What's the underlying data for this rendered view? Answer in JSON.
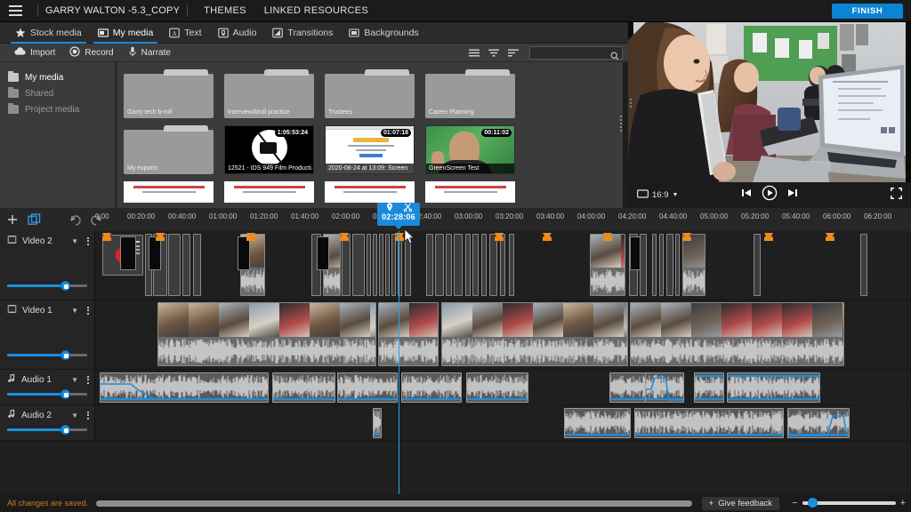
{
  "app": {
    "title": "GARRY WALTON -5.3_COPY",
    "nav": [
      "THEMES",
      "LINKED RESOURCES"
    ],
    "finish_label": "FINISH",
    "menu_icon": "hamburger-icon"
  },
  "media_tabs": [
    {
      "label": "Stock media",
      "icon": "star-icon",
      "active": false
    },
    {
      "label": "My media",
      "icon": "media-library-icon",
      "active": true
    },
    {
      "label": "Text",
      "icon": "text-icon",
      "active": false
    },
    {
      "label": "Audio",
      "icon": "audio-note-icon",
      "active": false
    },
    {
      "label": "Transitions",
      "icon": "transitions-icon",
      "active": false
    },
    {
      "label": "Backgrounds",
      "icon": "backgrounds-icon",
      "active": false
    }
  ],
  "action_bar": {
    "actions": [
      {
        "label": "Import",
        "icon": "cloud-upload-icon"
      },
      {
        "label": "Record",
        "icon": "record-circle-icon"
      },
      {
        "label": "Narrate",
        "icon": "microphone-icon"
      }
    ],
    "tools": [
      "list-view-icon",
      "filter-icon",
      "sort-icon"
    ],
    "search_placeholder": "",
    "search_value": "",
    "search_icon": "search-icon"
  },
  "left_nav": [
    {
      "label": "My media",
      "selected": true
    },
    {
      "label": "Shared",
      "selected": false
    },
    {
      "label": "Project media",
      "selected": false
    }
  ],
  "media_items": [
    {
      "type": "folder",
      "name": "Garry tech b-roll"
    },
    {
      "type": "folder",
      "name": "Interview/broll practice"
    },
    {
      "type": "folder",
      "name": "Trustees"
    },
    {
      "type": "folder",
      "name": "Career Planning"
    },
    {
      "type": "folder",
      "name": "My exports"
    },
    {
      "type": "video",
      "name": "12521 - IDS 949 Film Producti...",
      "duration": "1:05:53:24",
      "thumb": "no-video-icon"
    },
    {
      "type": "video",
      "name": "2020-08-24 at 13:09: Screen",
      "duration": "01:07:18",
      "thumb": "screen-recording"
    },
    {
      "type": "video",
      "name": "GreenScreen Test",
      "duration": "00:11:02",
      "thumb": "green-screen"
    },
    {
      "type": "document",
      "name": ""
    },
    {
      "type": "document",
      "name": ""
    },
    {
      "type": "document",
      "name": ""
    },
    {
      "type": "document",
      "name": ""
    }
  ],
  "preview": {
    "aspect_ratio": "16:9",
    "aspect_icon": "screen-icon",
    "controls": [
      "previous-frame-icon",
      "play-icon",
      "next-frame-icon"
    ],
    "fullscreen_icon": "fullscreen-icon"
  },
  "timeline": {
    "toolbar": [
      "add-icon",
      "group-icon",
      "undo-icon",
      "redo-icon"
    ],
    "playhead_timecode": "02:28:06",
    "playhead_icons": [
      "marker-pin-icon",
      "scissors-icon"
    ],
    "ruler_labels": [
      "0:00",
      "00:20:00",
      "00:40:00",
      "01:00:00",
      "01:20:00",
      "01:40:00",
      "02:00:00",
      "02:20:00",
      "02:40:00",
      "03:00:00",
      "03:20:00",
      "03:40:00",
      "04:00:00",
      "04:20:00",
      "04:40:00",
      "05:00:00",
      "05:20:00",
      "05:40:00",
      "06:00:00",
      "06:20:00"
    ],
    "tracks": [
      {
        "name": "Video 2",
        "type": "video",
        "icon": "video-track-icon",
        "volume": 72
      },
      {
        "name": "Video 1",
        "type": "video",
        "icon": "video-track-icon",
        "volume": 72
      },
      {
        "name": "Audio 1",
        "type": "audio",
        "icon": "audio-track-icon",
        "volume": 72
      },
      {
        "name": "Audio 2",
        "type": "audio",
        "icon": "audio-track-icon",
        "volume": 72
      }
    ],
    "marker_count": 11
  },
  "status": {
    "saved_text": "All changes are saved.",
    "feedback_label": "Give feedback",
    "feedback_icon": "plus-icon",
    "zoom_out_icon": "minus-sign",
    "zoom_in_icon": "plus-sign",
    "zoom_value": 6
  },
  "colors": {
    "accent": "#1c8adb",
    "marker": "#f08a1e",
    "saved_text": "#d07c1e",
    "panel": "#3b3b3b",
    "timeline_bg": "#1f1f1f"
  }
}
